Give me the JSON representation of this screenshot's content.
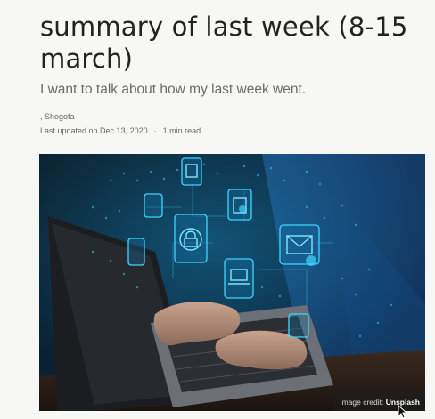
{
  "article": {
    "title": "summary of last week (8-15 march)",
    "subtitle": "I want to talk about how my last week went.",
    "author_line": ", Shogofa",
    "updated": "Last updated on Dec 13, 2020",
    "separator": "·",
    "read_time": "1 min read"
  },
  "hero": {
    "credit_prefix": "Image credit:",
    "credit_source": "Unsplash"
  },
  "colors": {
    "background": "#f7f8f6",
    "title": "#222222",
    "muted": "#6b6b6b",
    "glow": "#27c4ef"
  },
  "icons": {
    "cursor": "mouse-pointer-icon"
  }
}
